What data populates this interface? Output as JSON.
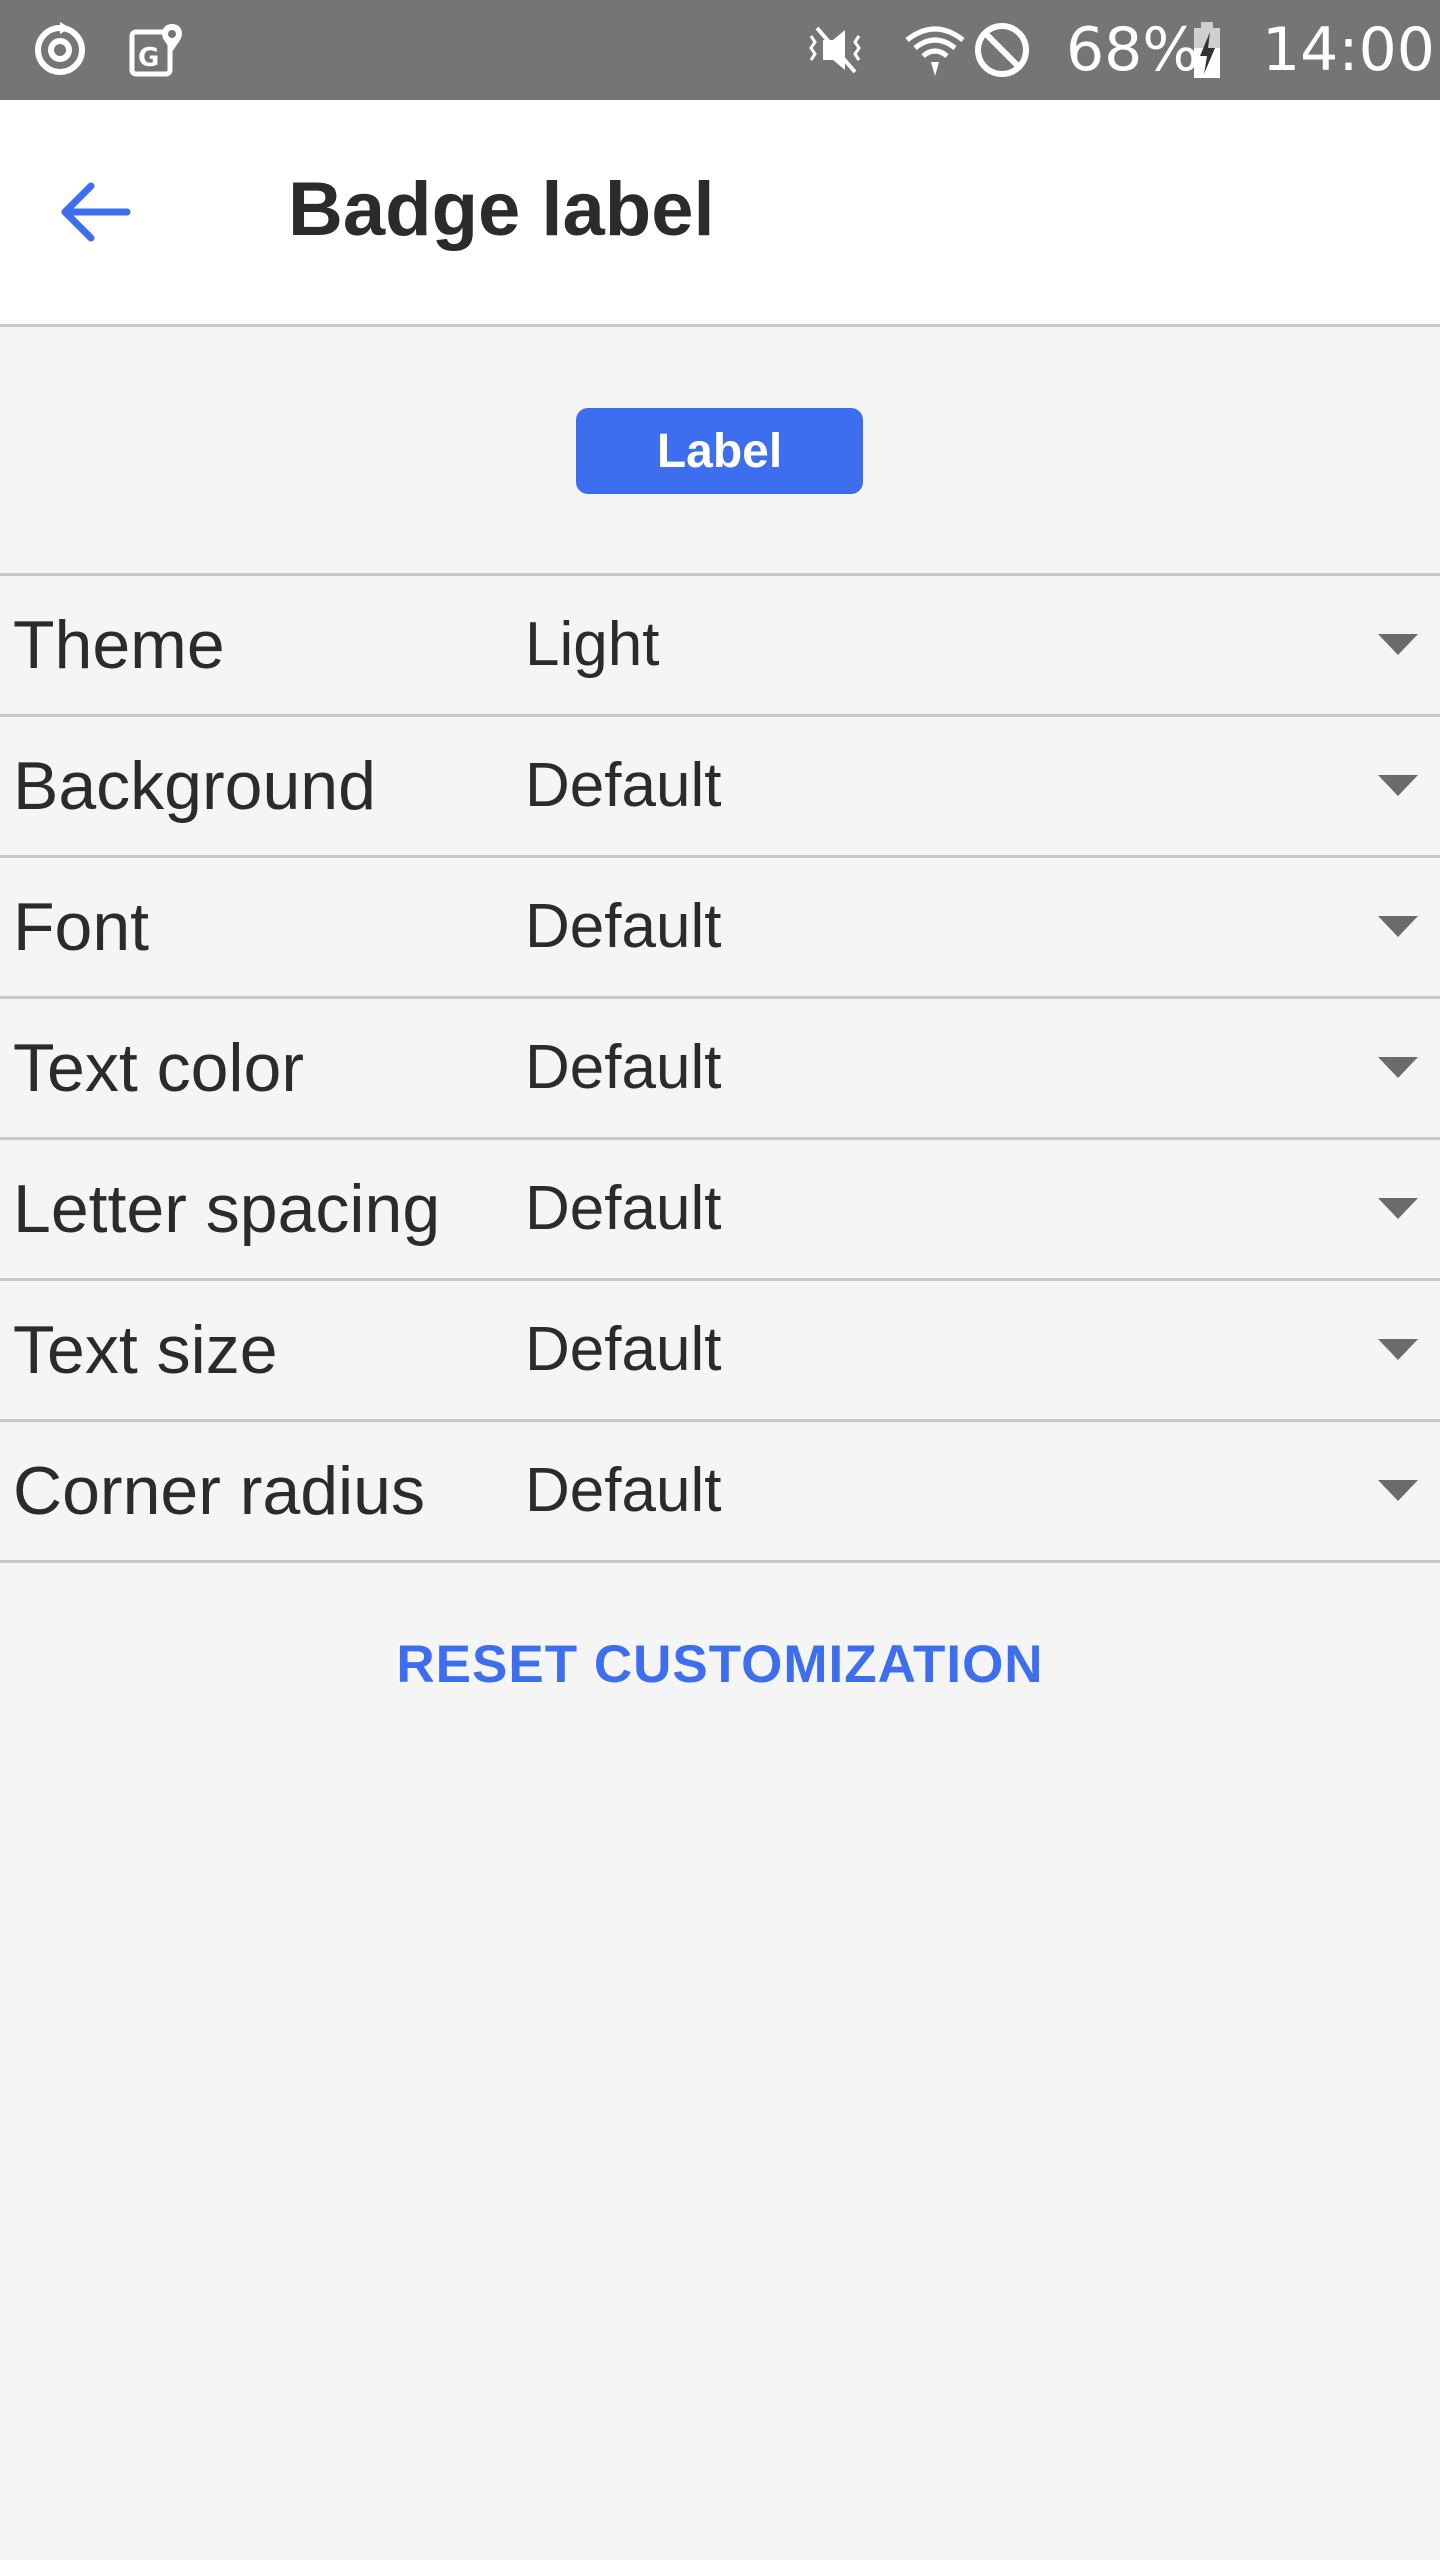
{
  "status_bar": {
    "battery": "68%",
    "time": "14:00",
    "icons": [
      "sync-icon",
      "maps-icon",
      "vibrate-icon",
      "wifi-icon",
      "block-icon",
      "battery-charging-icon"
    ]
  },
  "header": {
    "title": "Badge label",
    "back_icon": "arrow-left-icon"
  },
  "preview": {
    "badge_text": "Label"
  },
  "options": [
    {
      "label": "Theme",
      "value": "Light"
    },
    {
      "label": "Background",
      "value": "Default"
    },
    {
      "label": "Font",
      "value": "Default"
    },
    {
      "label": "Text color",
      "value": "Default"
    },
    {
      "label": "Letter spacing",
      "value": "Default"
    },
    {
      "label": "Text size",
      "value": "Default"
    },
    {
      "label": "Corner radius",
      "value": "Default"
    }
  ],
  "actions": {
    "reset_label": "RESET CUSTOMIZATION"
  },
  "colors": {
    "accent": "#3d6ef0",
    "status_bar": "#757575",
    "divider": "#c8c8c8",
    "background": "#f5f5f5"
  }
}
